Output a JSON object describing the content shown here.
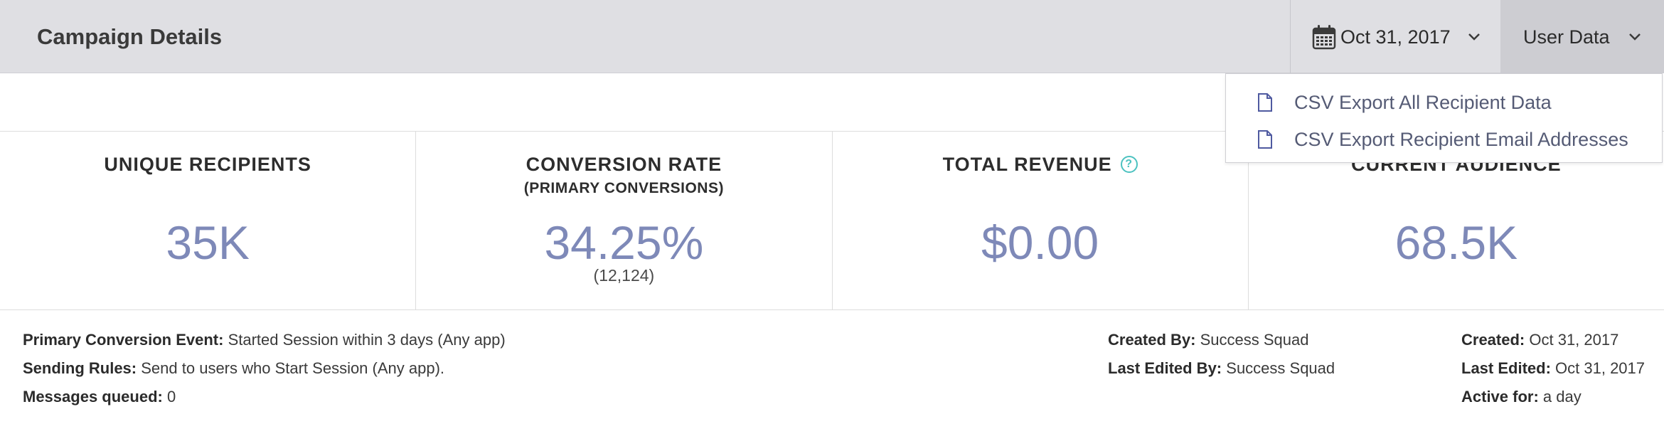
{
  "header": {
    "title": "Campaign Details",
    "date": "Oct 31, 2017",
    "date_icon": "calendar-icon",
    "user_data_label": "User Data"
  },
  "dropdown": {
    "items": [
      {
        "label": "CSV Export All Recipient Data",
        "icon": "document-icon"
      },
      {
        "label": "CSV Export Recipient Email Addresses",
        "icon": "document-icon"
      }
    ]
  },
  "stats": {
    "unique_recipients": {
      "label": "UNIQUE RECIPIENTS",
      "value": "35K"
    },
    "conversion_rate": {
      "label": "CONVERSION RATE",
      "sublabel": "(PRIMARY CONVERSIONS)",
      "value": "34.25%",
      "count": "(12,124)"
    },
    "total_revenue": {
      "label": "TOTAL REVENUE",
      "help": "?",
      "value": "$0.00"
    },
    "current_audience": {
      "label": "CURRENT AUDIENCE",
      "value": "68.5K"
    }
  },
  "meta": {
    "primary_conversion_event": {
      "key": "Primary Conversion Event:",
      "value": "Started Session within 3 days (Any app)"
    },
    "sending_rules": {
      "key": "Sending Rules:",
      "value": "Send to users who Start Session (Any app)."
    },
    "messages_queued": {
      "key": "Messages queued:",
      "value": "0"
    },
    "created_by": {
      "key": "Created By:",
      "value": "Success Squad"
    },
    "last_edited_by": {
      "key": "Last Edited By:",
      "value": "Success Squad"
    },
    "created": {
      "key": "Created:",
      "value": "Oct 31, 2017"
    },
    "last_edited": {
      "key": "Last Edited:",
      "value": "Oct 31, 2017"
    },
    "active_for": {
      "key": "Active for:",
      "value": "a day"
    }
  },
  "colors": {
    "accent_value": "#7e89b8",
    "help_icon": "#4cc2c0",
    "header_bg": "#dfdfe3",
    "user_data_bg": "#cdcdd2"
  }
}
